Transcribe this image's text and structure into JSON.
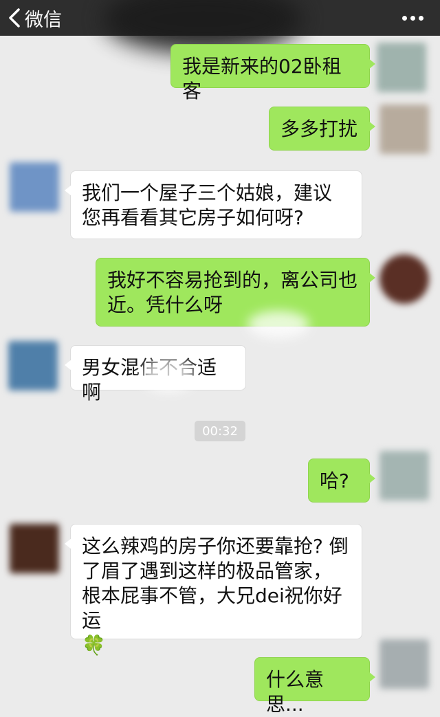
{
  "topbar": {
    "back_label": "微信",
    "back_icon": "chevron-left-icon",
    "more_icon": "more-dots-icon"
  },
  "messages": [
    {
      "side": "me",
      "text": "我是新来的02卧租客"
    },
    {
      "side": "me",
      "text": "多多打扰"
    },
    {
      "side": "other",
      "text": "我们一个屋子三个姑娘，建议您再看看其它房子如何呀?"
    },
    {
      "side": "me",
      "text": "我好不容易抢到的，离公司也近。凭什么呀"
    },
    {
      "side": "other",
      "text": "男女混住不合适啊"
    },
    {
      "side": "me",
      "text": "哈?"
    },
    {
      "side": "other",
      "text": "这么辣鸡的房子你还要靠抢? 倒了眉了遇到这样的极品管家，根本屁事不管，大兄dei祝你好运",
      "emoji": "🍀"
    },
    {
      "side": "me",
      "text": "什么意思..."
    }
  ],
  "timestamp": "00:32",
  "colors": {
    "topbar": "#2e2e2e",
    "background": "#ebebeb",
    "bubble_me": "#9fe75d",
    "bubble_other": "#ffffff"
  }
}
